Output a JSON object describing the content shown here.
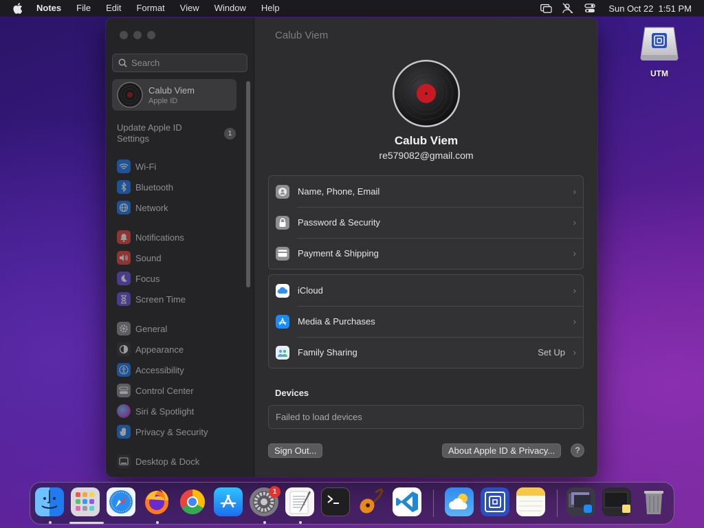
{
  "menubar": {
    "app_name": "Notes",
    "items": [
      "File",
      "Edit",
      "Format",
      "View",
      "Window",
      "Help"
    ],
    "clock": "Sun Oct 22  1:51 PM"
  },
  "desktop": {
    "icon_label": "UTM"
  },
  "window": {
    "title": "Calub Viem",
    "sidebar": {
      "search_placeholder": "Search",
      "account": {
        "name": "Calub Viem",
        "subtitle": "Apple ID"
      },
      "update": {
        "label": "Update Apple ID Settings",
        "badge": "1"
      },
      "items": [
        {
          "label": "Wi-Fi",
          "icon": "wifi-icon",
          "color": "#1a7cf0"
        },
        {
          "label": "Bluetooth",
          "icon": "bluetooth-icon",
          "color": "#1a7cf0"
        },
        {
          "label": "Network",
          "icon": "globe-icon",
          "color": "#1a7cf0"
        },
        {
          "label": "Notifications",
          "icon": "bell-icon",
          "color": "#e5433b"
        },
        {
          "label": "Sound",
          "icon": "speaker-icon",
          "color": "#e5433b"
        },
        {
          "label": "Focus",
          "icon": "moon-icon",
          "color": "#6a4ee0"
        },
        {
          "label": "Screen Time",
          "icon": "hourglass-icon",
          "color": "#6a4ee0"
        },
        {
          "label": "General",
          "icon": "gear-icon",
          "color": "#8e8e93"
        },
        {
          "label": "Appearance",
          "icon": "appearance-icon",
          "color": "#333336"
        },
        {
          "label": "Accessibility",
          "icon": "accessibility-icon",
          "color": "#1a7cf0"
        },
        {
          "label": "Control Center",
          "icon": "control-center-icon",
          "color": "#8e8e93"
        },
        {
          "label": "Siri & Spotlight",
          "icon": "siri-icon",
          "color": "#c04ae0"
        },
        {
          "label": "Privacy & Security",
          "icon": "hand-icon",
          "color": "#1a7cf0"
        },
        {
          "label": "Desktop & Dock",
          "icon": "dock-icon",
          "color": "#333336"
        }
      ]
    },
    "profile": {
      "name": "Calub Viem",
      "email": "re579082@gmail.com"
    },
    "group1": [
      {
        "label": "Name, Phone, Email",
        "icon": "contact-card-icon",
        "color": "#8e8e93"
      },
      {
        "label": "Password & Security",
        "icon": "lock-icon",
        "color": "#8e8e93"
      },
      {
        "label": "Payment & Shipping",
        "icon": "credit-card-icon",
        "color": "#8e8e93"
      }
    ],
    "group2": [
      {
        "label": "iCloud",
        "icon": "icloud-icon",
        "color": "#ffffff",
        "value": ""
      },
      {
        "label": "Media & Purchases",
        "icon": "app-store-icon",
        "color": "#1a8cf5",
        "value": ""
      },
      {
        "label": "Family Sharing",
        "icon": "family-icon",
        "color": "#e8eef6",
        "value": "Set Up"
      }
    ],
    "devices": {
      "heading": "Devices",
      "status": "Failed to load devices"
    },
    "buttons": {
      "sign_out": "Sign Out...",
      "about": "About Apple ID & Privacy...",
      "help": "?"
    }
  },
  "dock": {
    "system_settings_badge": "1",
    "apps": [
      "Finder",
      "Launchpad",
      "Safari",
      "Firefox",
      "Chrome",
      "App Store",
      "System Settings",
      "TextEdit",
      "Terminal",
      "GarageBand",
      "Visual Studio Code",
      "Weather",
      "UTM",
      "Notes",
      "Downloads",
      "Documents",
      "Trash"
    ]
  }
}
